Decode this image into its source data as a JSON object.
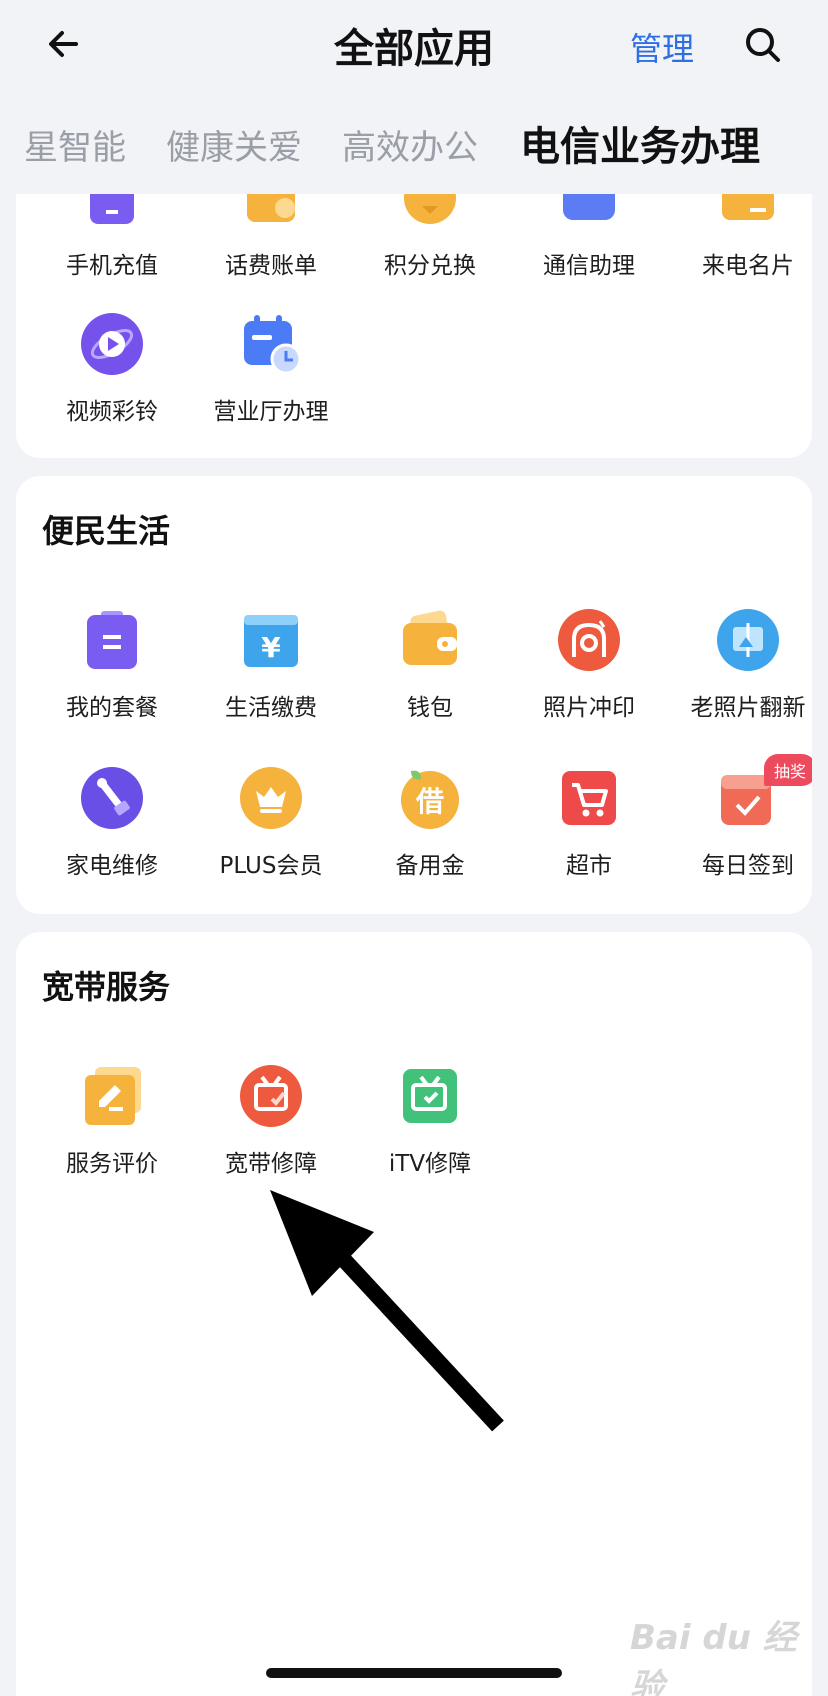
{
  "header": {
    "title": "全部应用",
    "manage_label": "管理"
  },
  "tabs": [
    {
      "label": "星智能",
      "active": false
    },
    {
      "label": "健康关爱",
      "active": false
    },
    {
      "label": "高效办公",
      "active": false
    },
    {
      "label": "电信业务办理",
      "active": true
    }
  ],
  "telecom_section": {
    "row1": [
      {
        "label": "手机充值",
        "icon": "phone-recharge-icon",
        "color": "#7a5cf0"
      },
      {
        "label": "话费账单",
        "icon": "bill-icon",
        "color": "#f5b23d"
      },
      {
        "label": "积分兑换",
        "icon": "points-icon",
        "color": "#f5b23d"
      },
      {
        "label": "通信助理",
        "icon": "assistant-icon",
        "color": "#5b7cf3"
      },
      {
        "label": "来电名片",
        "icon": "caller-card-icon",
        "color": "#f5b23d"
      }
    ],
    "row2": [
      {
        "label": "视频彩铃",
        "icon": "video-ringtone-icon",
        "color": "#7652ec"
      },
      {
        "label": "营业厅办理",
        "icon": "business-hall-icon",
        "color": "#4c7cf5"
      }
    ]
  },
  "life_section": {
    "title": "便民生活",
    "row1": [
      {
        "label": "我的套餐",
        "icon": "package-icon",
        "color": "#7b5cf0"
      },
      {
        "label": "生活缴费",
        "icon": "utility-payment-icon",
        "color": "#3ea4ec"
      },
      {
        "label": "钱包",
        "icon": "wallet-icon",
        "color": "#f5b23d"
      },
      {
        "label": "照片冲印",
        "icon": "photo-print-icon",
        "color": "#ee5a3d"
      },
      {
        "label": "老照片翻新",
        "icon": "photo-restore-icon",
        "color": "#3ea4ec"
      }
    ],
    "row2": [
      {
        "label": "家电维修",
        "icon": "appliance-repair-icon",
        "color": "#6a4fe6"
      },
      {
        "label": "PLUS会员",
        "icon": "plus-member-icon",
        "color": "#f5b23d"
      },
      {
        "label": "备用金",
        "icon": "reserve-fund-icon",
        "color": "#f5b23d"
      },
      {
        "label": "超市",
        "icon": "supermarket-icon",
        "color": "#ee4a4a"
      },
      {
        "label": "每日签到",
        "icon": "daily-checkin-icon",
        "color": "#f06a55",
        "badge": "抽奖"
      }
    ]
  },
  "broadband_section": {
    "title": "宽带服务",
    "items": [
      {
        "label": "服务评价",
        "icon": "service-review-icon",
        "color": "#f5b23d"
      },
      {
        "label": "宽带修障",
        "icon": "broadband-repair-icon",
        "color": "#ee5a3d"
      },
      {
        "label": "iTV修障",
        "icon": "itv-repair-icon",
        "color": "#42c17b"
      }
    ]
  },
  "watermark": "Bai du 经验"
}
